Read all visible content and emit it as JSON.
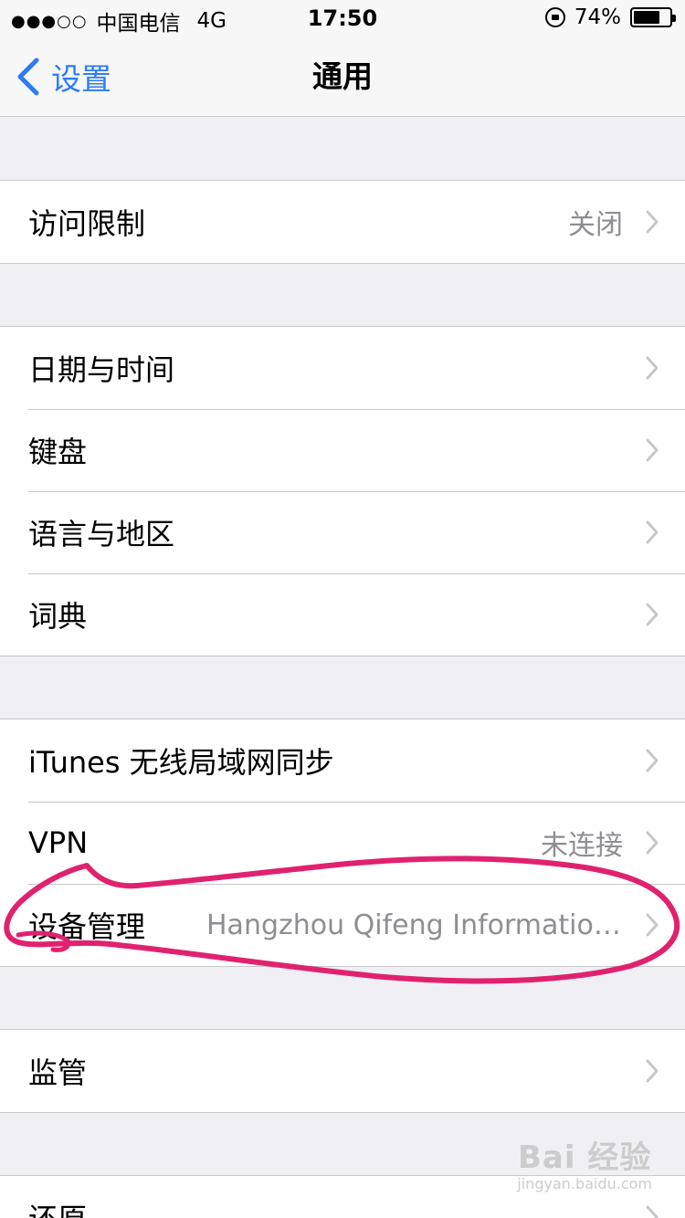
{
  "status_bar": {
    "signal": "●●●○○",
    "carrier": "中国电信",
    "network": "4G",
    "time": "17:50",
    "battery_percent": "74%",
    "battery_level": 0.74
  },
  "nav": {
    "back_label": "设置",
    "title": "通用"
  },
  "groups": [
    {
      "rows": [
        {
          "label": "访问限制",
          "value": "关闭"
        }
      ]
    },
    {
      "rows": [
        {
          "label": "日期与时间",
          "value": ""
        },
        {
          "label": "键盘",
          "value": ""
        },
        {
          "label": "语言与地区",
          "value": ""
        },
        {
          "label": "词典",
          "value": ""
        }
      ]
    },
    {
      "rows": [
        {
          "label": "iTunes 无线局域网同步",
          "value": ""
        },
        {
          "label": "VPN",
          "value": "未连接"
        },
        {
          "label": "设备管理",
          "value": "Hangzhou Qifeng Information..."
        }
      ]
    },
    {
      "rows": [
        {
          "label": "监管",
          "value": ""
        }
      ]
    },
    {
      "rows": [
        {
          "label": "还原",
          "value": ""
        }
      ]
    }
  ],
  "colors": {
    "accent": "#2d7cf6",
    "annotation": "#e0226e",
    "secondary_text": "#8e8e93"
  },
  "watermark": {
    "logo": "Bai 经验",
    "url": "jingyan.baidu.com"
  }
}
